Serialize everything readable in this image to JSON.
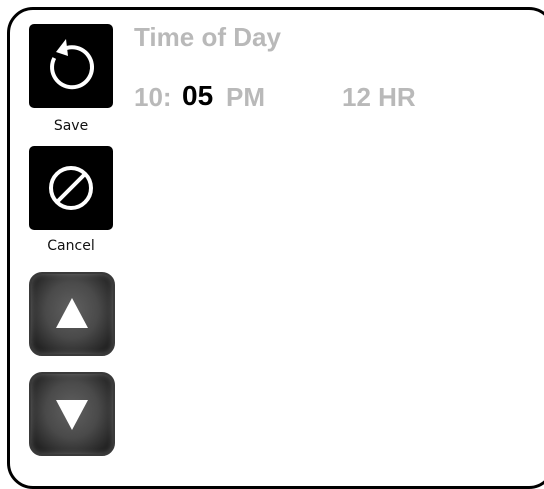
{
  "screen": {
    "title": "Time of Day"
  },
  "time": {
    "hour": "10:",
    "minute": "05",
    "ampm": "PM",
    "mode": "12 HR"
  },
  "buttons": {
    "save_label": "Save",
    "cancel_label": "Cancel",
    "save_icon": "refresh-circle-arrow-icon",
    "cancel_icon": "prohibited-icon",
    "up_icon": "triangle-up-icon",
    "down_icon": "triangle-down-icon"
  },
  "colors": {
    "inactive_text": "#b9b9b9",
    "active_text": "#000000",
    "button_bg": "#000000"
  }
}
